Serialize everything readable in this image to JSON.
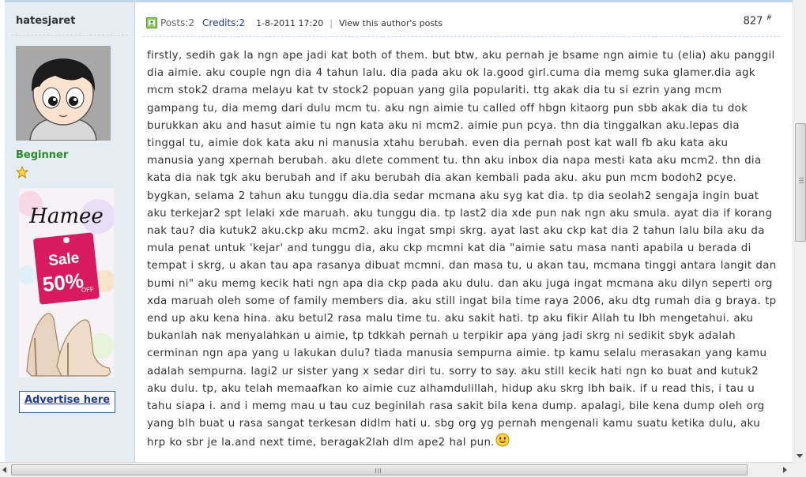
{
  "author": {
    "username": "hatesjaret",
    "rank": "Beginner",
    "star_icon": "star-icon",
    "avatar_icon": "cartoon-avatar-icon"
  },
  "sidebar_ad": {
    "brand": "Hamee",
    "sale_label": "Sale",
    "discount": "50%",
    "discount_suffix": "OFF",
    "advertise_link": "Advertise here"
  },
  "post_header": {
    "posts": "Posts:2",
    "credits": "Credits:2",
    "date": "1-8-2011 17:20",
    "separator": "|",
    "view_author": "View this author's posts",
    "post_number": "827",
    "post_number_mark": "#"
  },
  "post_body": {
    "text": "firstly, sedih gak la ngn ape jadi kat both of them. but btw, aku pernah je bsame ngn aimie tu (elia) aku panggil dia aimie. aku couple ngn dia 4 tahun lalu. dia pada aku ok la.good girl.cuma dia memg suka glamer.dia agk mcm stok2 drama melayu kat tv stock2 popuan yang gila populariti. ttg akak dia tu si ezrin yang mcm gampang tu, dia memg dari dulu mcm tu. aku ngn aimie tu called off hbgn kitaorg pun sbb akak dia tu dok burukkan aku and hasut aimie tu ngn kata aku ni mcm2. aimie pun pcya. thn dia tinggalkan aku.lepas dia tinggal tu, aimie dok kata aku ni manusia xtahu berubah. even dia pernah post kat wall fb aku kata aku manusia yang xpernah berubah. aku dlete comment tu. thn aku inbox dia napa mesti kata aku mcm2. thn dia kata dia nak tgk aku berubah and if aku berubah dia akan kembali pada aku. aku pun mcm bodoh2 pcye. bygkan, selama 2 tahun aku tunggu dia.dia sedar mcmana aku syg kat dia. tp dia seolah2 sengaja ingin buat aku terkejar2 spt lelaki xde maruah. aku tunggu dia. tp last2 dia xde pun nak ngn aku smula. ayat dia if korang nak tau? dia kutuk2 aku.ckp aku mcm2. aku ingat smpi skrg. ayat last aku ckp kat dia 2 tahun lalu bila aku da mula penat untuk 'kejar' and tunggu dia, aku ckp mcmni kat dia \"aimie satu masa nanti apabila u berada di tempat i skrg, u akan tau apa rasanya dibuat mcmni. dan masa tu, u akan tau, mcmana tinggi antara langit dan bumi ni\" aku memg kecik hati ngn apa dia ckp pada aku dulu. dan aku juga ingat mcmana aku dilyn seperti org xda maruah oleh some of family members dia. aku still ingat bila time raya 2006, aku dtg rumah dia g braya. tp end up aku kena hina. aku betul2 rasa malu time tu. aku sakit hati. tp aku fikir Allah tu lbh mengetahui. aku bukanlah nak menyalahkan u aimie, tp tdkkah pernah u terpikir apa yang jadi skrg ni sedikit sbyk adalah cerminan ngn apa yang u lakukan dulu? tiada manusia sempurna aimie. tp kamu selalu merasakan yang kamu adalah sempurna. lagi2 ur sister yang x sedar diri tu. sorry to say. aku still kecik hati ngn ko buat and kutuk2 aku dulu. tp, aku telah memaafkan ko aimie cuz alhamdulillah, hidup aku skrg lbh baik. if u read this, i tau u tahu siapa i. and i memg mau u tau cuz beginilah rasa sakit bila kena dump. apalagi, bile kena dump oleh org yang blh buat u rasa sangat terkesan didlm hati u. sbg org yg pernah mengenali kamu suatu ketika dulu, aku hrp ko sbr je la.and next time, beragak2lah dlm ape2 hal pun.",
    "smiley_icon": "smiley-icon"
  },
  "colors": {
    "sidebar_bg": "#e5edf2",
    "border": "#c2d5e3",
    "rank_green": "#2c8a2c",
    "link_blue": "#1f3a93",
    "text": "#333333"
  }
}
